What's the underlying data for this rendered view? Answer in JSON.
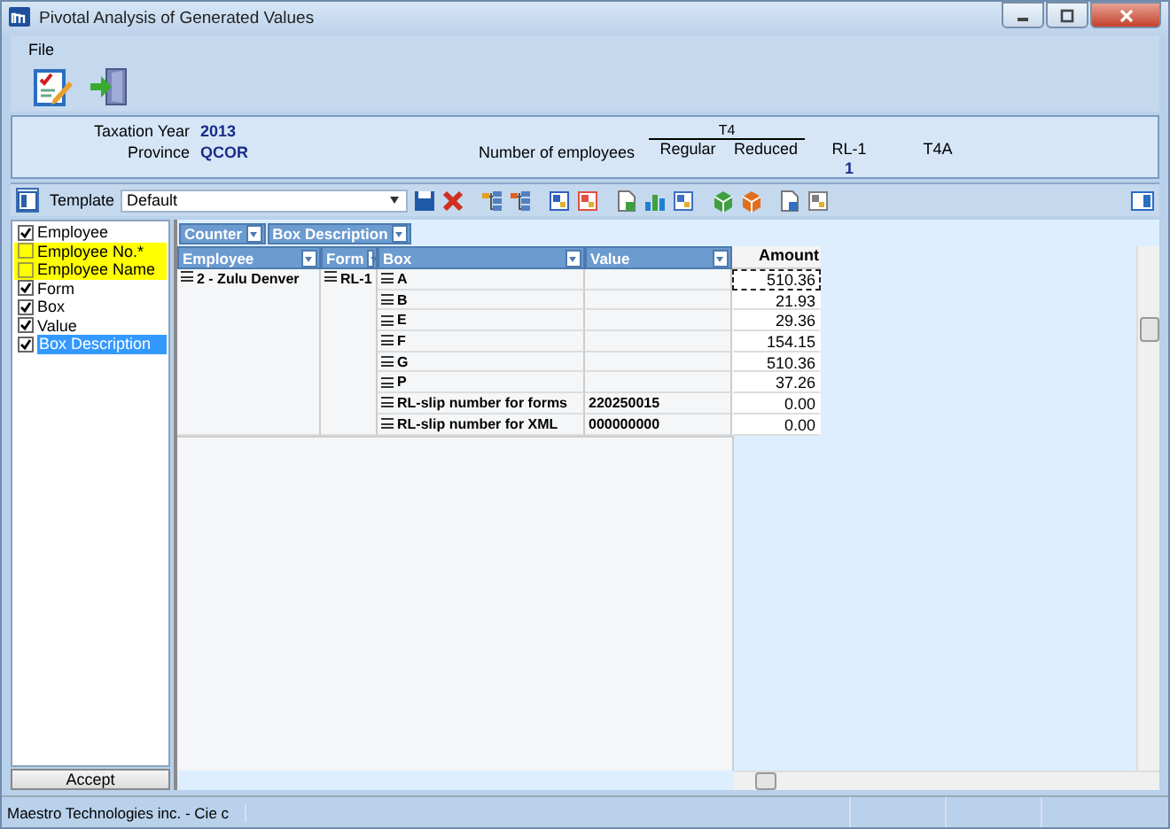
{
  "window": {
    "title": "Pivotal Analysis of Generated Values"
  },
  "menu": [
    "File"
  ],
  "info": {
    "taxation_year_label": "Taxation Year",
    "taxation_year": "2013",
    "province_label": "Province",
    "province": "QCOR",
    "employees_label": "Number of employees",
    "group_header": "T4",
    "columns": [
      {
        "label": "Regular"
      },
      {
        "label": "Reduced"
      },
      {
        "label": "RL-1",
        "value": "1"
      },
      {
        "label": "T4A"
      }
    ]
  },
  "template": {
    "label": "Template",
    "value": "Default"
  },
  "fields": [
    {
      "label": "Employee",
      "checked": true,
      "highlighted": false,
      "selected": false
    },
    {
      "label": "Employee No.*",
      "checked": false,
      "highlighted": true,
      "selected": false
    },
    {
      "label": "Employee Name",
      "checked": false,
      "highlighted": true,
      "selected": false
    },
    {
      "label": "Form",
      "checked": true,
      "highlighted": false,
      "selected": false
    },
    {
      "label": "Box",
      "checked": true,
      "highlighted": false,
      "selected": false
    },
    {
      "label": "Value",
      "checked": true,
      "highlighted": false,
      "selected": false
    },
    {
      "label": "Box Description",
      "checked": true,
      "highlighted": false,
      "selected": true
    }
  ],
  "accept_button": "Accept",
  "filter_fields": [
    "Counter",
    "Box Description"
  ],
  "row_fields": [
    "Employee",
    "Form",
    "Box",
    "Value"
  ],
  "data_header": "Amount",
  "employee": "2 - Zulu Denver",
  "form": "RL-1",
  "rows": [
    {
      "box": "A",
      "value": "",
      "amount": "510.36",
      "selected": true
    },
    {
      "box": "B",
      "value": "",
      "amount": "21.93",
      "selected": false
    },
    {
      "box": "E",
      "value": "",
      "amount": "29.36",
      "selected": false
    },
    {
      "box": "F",
      "value": "",
      "amount": "154.15",
      "selected": false
    },
    {
      "box": "G",
      "value": "",
      "amount": "510.36",
      "selected": false
    },
    {
      "box": "P",
      "value": "",
      "amount": "37.26",
      "selected": false
    },
    {
      "box": "RL-slip number for forms",
      "value": "220250015",
      "amount": "0.00",
      "selected": false
    },
    {
      "box": "RL-slip number for XML",
      "value": "000000000",
      "amount": "0.00",
      "selected": false
    }
  ],
  "status_bar": [
    "Maestro Technologies inc. - Cie c"
  ]
}
